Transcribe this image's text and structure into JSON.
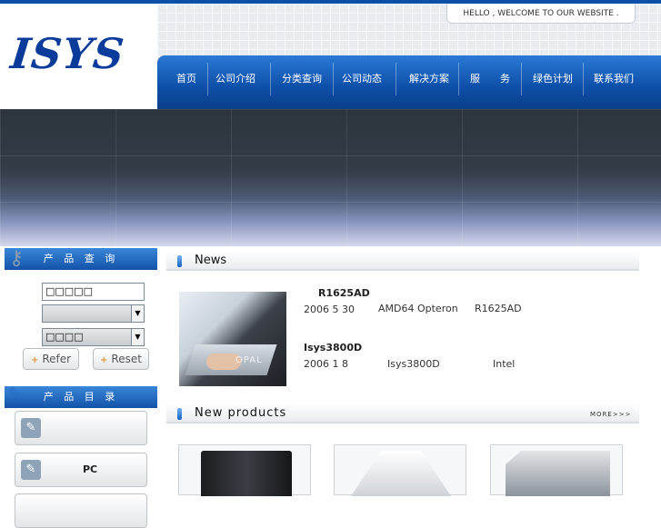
{
  "header": {
    "logo_text": "ISYS",
    "welcome_text": "HELLO , WELCOME TO OUR WEBSITE ."
  },
  "nav": {
    "items": [
      "首页",
      "公司介绍",
      "分类查询",
      "公司动态",
      "解决方案",
      "服　　务",
      "绿色计划",
      "联系我们"
    ]
  },
  "sidebar": {
    "search_title": "产 品 查 询",
    "search_input_value": "□□□□□",
    "select1_value": "",
    "select2_value": "□□□□",
    "refer_label": "Refer",
    "reset_label": "Reset",
    "catalog_title": "产 品 目 录",
    "catalog_items": [
      "",
      "PC",
      ""
    ]
  },
  "news": {
    "title": "News",
    "items": [
      {
        "title": "R1625AD",
        "date": "2006 5 30",
        "col2": "AMD64 Opteron",
        "col3": "R1625AD"
      },
      {
        "title": "Isys3800D",
        "date": "2006 1 8",
        "col2": "Isys3800D",
        "col3": "Intel"
      }
    ],
    "image_brand": "OPAL"
  },
  "products": {
    "title": "New products",
    "more_label": "MORE>>>"
  },
  "colors": {
    "nav_blue": "#0d4fa8",
    "banner_dark": "#2c343d",
    "accent_orange": "#e07a10"
  }
}
